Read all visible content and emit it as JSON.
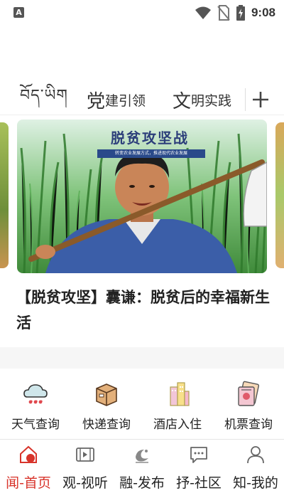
{
  "status_bar": {
    "app_icon_letter": "A",
    "time": "9:08",
    "icons": [
      "wifi-icon",
      "no-sim-icon",
      "battery-charging-icon"
    ]
  },
  "tabs": [
    {
      "label": "བོད་ཡིག"
    },
    {
      "first_char": "党",
      "rest": "建引领"
    },
    {
      "first_char": "文",
      "rest": "明实践"
    }
  ],
  "add_tab_icon": "plus-icon",
  "carousel": {
    "image_title": "脱贫攻坚战",
    "image_subtitle": "转变农业发展方式，推进现代农业发展"
  },
  "headline": "【脱贫攻坚】囊谦：脱贫后的幸福新生活",
  "services": [
    {
      "label": "天气查询",
      "icon": "weather-cloud-icon"
    },
    {
      "label": "快递查询",
      "icon": "package-box-icon"
    },
    {
      "label": "酒店入住",
      "icon": "hotel-building-icon"
    },
    {
      "label": "机票查询",
      "icon": "flight-ticket-icon"
    }
  ],
  "bottom_nav": [
    {
      "label": "闻-首页",
      "icon": "home-icon",
      "active": true
    },
    {
      "label": "观-视听",
      "icon": "video-icon",
      "active": false
    },
    {
      "label": "融-发布",
      "icon": "publish-logo-icon",
      "active": false
    },
    {
      "label": "抒-社区",
      "icon": "chat-bubble-icon",
      "active": false
    },
    {
      "label": "知-我的",
      "icon": "user-profile-icon",
      "active": false
    }
  ],
  "colors": {
    "accent": "#d8342b",
    "text": "#222222",
    "icon_gray": "#666666"
  }
}
